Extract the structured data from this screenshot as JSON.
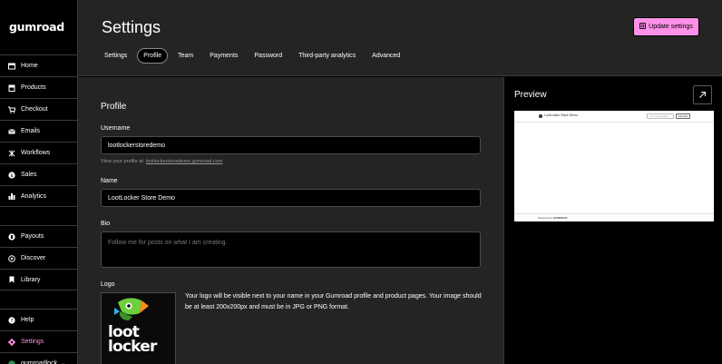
{
  "brand": {
    "logo_text": "Gumroad",
    "accent": "#ff90e8"
  },
  "sidebar": {
    "items": [
      {
        "label": "Home",
        "icon": "home-icon"
      },
      {
        "label": "Products",
        "icon": "box-icon"
      },
      {
        "label": "Checkout",
        "icon": "cart-icon"
      },
      {
        "label": "Emails",
        "icon": "mail-icon"
      },
      {
        "label": "Workflows",
        "icon": "workflow-icon"
      },
      {
        "label": "Sales",
        "icon": "dollar-icon"
      },
      {
        "label": "Analytics",
        "icon": "bar-chart-icon"
      },
      {
        "label": "Payouts",
        "icon": "bank-icon"
      },
      {
        "label": "Discover",
        "icon": "compass-icon"
      },
      {
        "label": "Library",
        "icon": "bookmark-icon"
      },
      {
        "label": "Help",
        "icon": "help-icon"
      },
      {
        "label": "Settings",
        "icon": "gear-icon"
      },
      {
        "label": "gumroadlock",
        "icon": "avatar-icon"
      }
    ]
  },
  "header": {
    "title": "Settings",
    "update_button": "Update settings",
    "tabs": [
      "Settings",
      "Profile",
      "Team",
      "Payments",
      "Password",
      "Third-party analytics",
      "Advanced"
    ],
    "active_tab": "Profile"
  },
  "profile": {
    "section_title": "Profile",
    "username_label": "Username",
    "username_value": "lootlockerstoredemo",
    "hint_prefix": "View your profile at:",
    "hint_link": "lootlockerstoredemo.gumroad.com",
    "name_label": "Name",
    "name_value": "LootLocker Store Demo",
    "bio_label": "Bio",
    "bio_placeholder": "Follow me for posts on what I am creating.",
    "logo_label": "Logo",
    "logo_image_text": [
      "loot",
      "locker"
    ],
    "logo_description": "Your logo will be visible next to your name in your Gumroad profile and product pages. Your image should be at least 200x200px and must be in JPG or PNG format."
  },
  "preview": {
    "title": "Preview",
    "store_name": "LootLocker Store Demo",
    "email_placeholder": "Your email address",
    "subscribe_label": "Subscribe",
    "powered_by": "Powered by",
    "powered_brand": "GUMROAD"
  }
}
